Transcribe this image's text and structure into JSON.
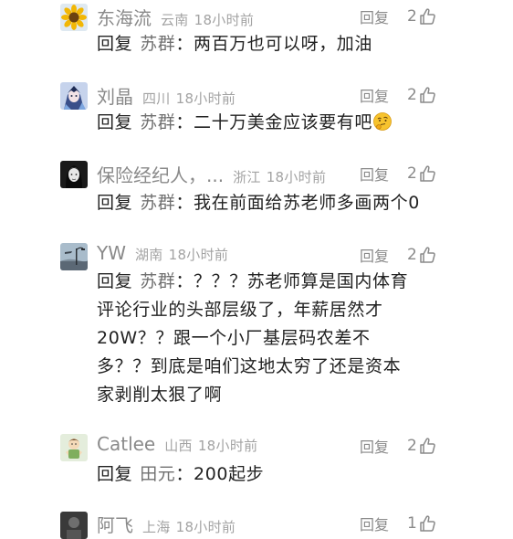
{
  "colors": {
    "username": "#8a8a8a",
    "meta": "#a3a3a3",
    "text": "#222222",
    "reply_target": "#707070"
  },
  "comments": [
    {
      "username": "东海流",
      "region": "云南",
      "time": "18小时前",
      "reply_label": "回复",
      "likes": "2",
      "reply_prefix": "回复",
      "reply_target": "苏群",
      "text": "：两百万也可以呀，加油",
      "avatar_icon": "sunflower-avatar-icon"
    },
    {
      "username": "刘晶",
      "region": "四川",
      "time": "18小时前",
      "reply_label": "回复",
      "likes": "2",
      "reply_prefix": "回复",
      "reply_target": "苏群",
      "text": "：二十万美金应该要有吧",
      "emoji": "thinking-emoji-icon",
      "avatar_icon": "anime-avatar-icon"
    },
    {
      "username": "保险经纪人，...",
      "region": "浙江",
      "time": "18小时前",
      "reply_label": "回复",
      "likes": "2",
      "reply_prefix": "回复",
      "reply_target": "苏群",
      "text": "：我在前面给苏老师多画两个0",
      "avatar_icon": "portrait-avatar-icon"
    },
    {
      "username": "YW",
      "region": "湖南",
      "time": "18小时前",
      "reply_label": "回复",
      "likes": "2",
      "reply_prefix": "回复",
      "reply_target": "苏群",
      "text_lines": [
        "：？？？苏老师算是国内体育",
        "评论行业的头部层级了，年薪居然才",
        "20W？？跟一个小厂基层码农差不",
        "多？？到底是咱们这地太穷了还是资本",
        "家剥削太狠了啊"
      ],
      "avatar_icon": "streetlight-avatar-icon"
    },
    {
      "username": "Catlee",
      "region": "山西",
      "time": "18小时前",
      "reply_label": "回复",
      "likes": "2",
      "reply_prefix": "回复",
      "reply_target": "田元",
      "text": "：200起步",
      "avatar_icon": "cartoon-avatar-icon"
    },
    {
      "username": "阿飞",
      "region": "上海",
      "time": "18小时前",
      "reply_label": "回复",
      "likes": "1",
      "avatar_icon": "dark-avatar-icon"
    }
  ]
}
